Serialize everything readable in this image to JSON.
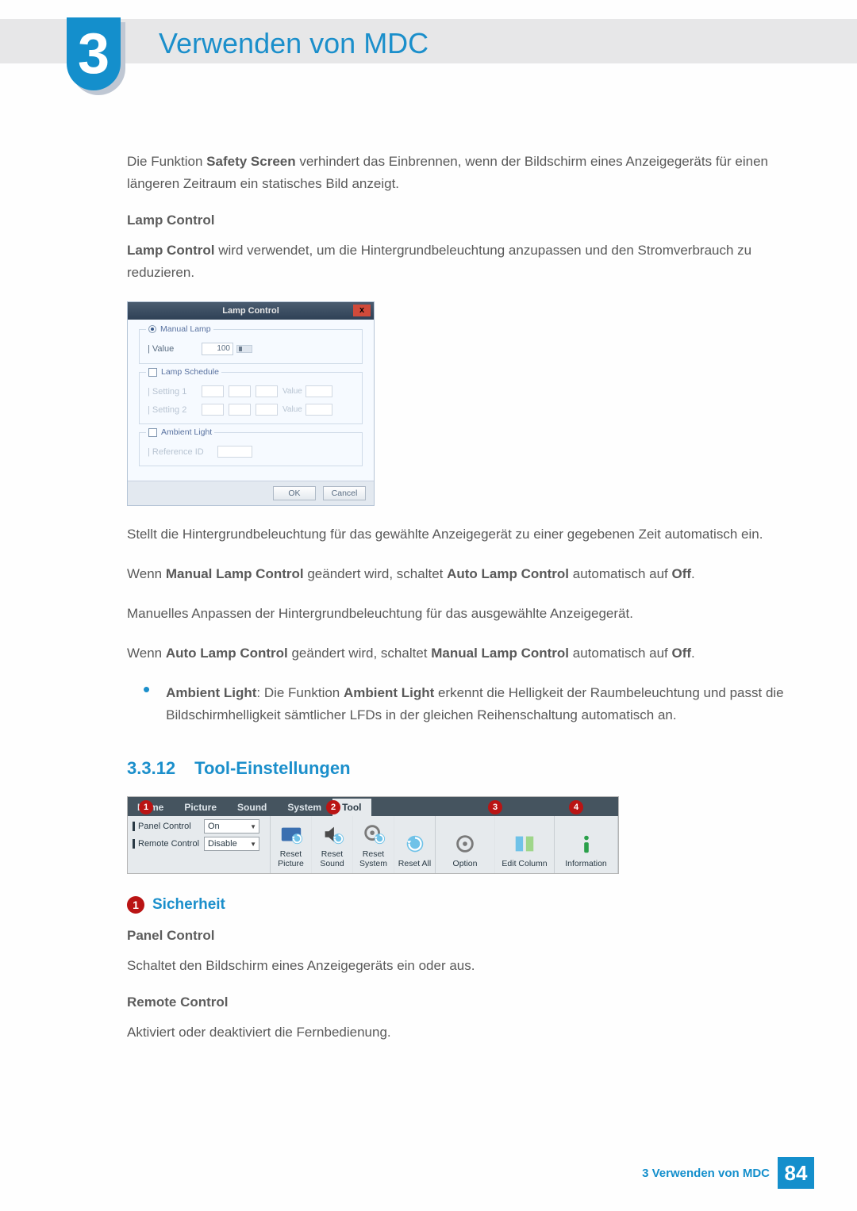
{
  "chapter_badge": "3",
  "chapter_title": "Verwenden von MDC",
  "intro": {
    "p1_pre": "Die Funktion ",
    "p1_b": "Safety Screen",
    "p1_post": " verhindert das Einbrennen, wenn der Bildschirm eines Anzeigegeräts für einen längeren Zeitraum ein statisches Bild anzeigt."
  },
  "lamp": {
    "heading": "Lamp Control",
    "p_pre": "",
    "p_b": "Lamp Control",
    "p_post": " wird verwendet, um die Hintergrundbeleuchtung anzupassen und den Stromverbrauch zu reduzieren.",
    "dialog": {
      "title": "Lamp Control",
      "close": "x",
      "manual_lamp_legend": "Manual Lamp",
      "value_label": "| Value",
      "value_val": "100",
      "schedule_legend": "Lamp Schedule",
      "setting1": "| Setting 1",
      "setting2": "| Setting 2",
      "sched_val_label": "Value",
      "ambient_legend": "Ambient Light",
      "ref_id": "| Reference ID",
      "ok": "OK",
      "cancel": "Cancel"
    },
    "para2": "Stellt die Hintergrundbeleuchtung für das gewählte Anzeigegerät zu einer gegebenen Zeit automatisch ein.",
    "para3_pre": "Wenn ",
    "para3_b1": "Manual Lamp Control",
    "para3_mid": " geändert wird, schaltet ",
    "para3_b2": "Auto Lamp Control",
    "para3_mid2": " automatisch auf ",
    "para3_b3": "Off",
    "para3_end": ".",
    "para4": "Manuelles Anpassen der Hintergrundbeleuchtung für das ausgewählte Anzeigegerät.",
    "para5_pre": "Wenn ",
    "para5_b1": "Auto Lamp Control",
    "para5_mid": " geändert wird, schaltet ",
    "para5_b2": "Manual Lamp Control",
    "para5_mid2": " automatisch auf ",
    "para5_b3": "Off",
    "para5_end": ".",
    "bullet_b1": "Ambient Light",
    "bullet_mid1": ": Die Funktion ",
    "bullet_b2": "Ambient Light",
    "bullet_rest": " erkennt die Helligkeit der Raumbeleuchtung und passt die Bildschirmhelligkeit sämtlicher LFDs in der gleichen Reihenschaltung automatisch an."
  },
  "section": {
    "num": "3.3.12",
    "title": "Tool-Einstellungen"
  },
  "toolbar": {
    "tabs": {
      "home": "Home",
      "picture": "Picture",
      "sound": "Sound",
      "system": "System",
      "tool": "Tool"
    },
    "panel_control_label": "Panel Control",
    "panel_control_value": "On",
    "remote_control_label": "Remote Control",
    "remote_control_value": "Disable",
    "reset_picture": "Reset Picture",
    "reset_sound": "Reset Sound",
    "reset_system": "Reset System",
    "reset_all": "Reset All",
    "option": "Option",
    "edit_column": "Edit Column",
    "information": "Information",
    "badges": {
      "b1": "1",
      "b2": "2",
      "b3": "3",
      "b4": "4"
    }
  },
  "sicherheit": {
    "badge": "1",
    "title": "Sicherheit",
    "panel_h": "Panel Control",
    "panel_p": "Schaltet den Bildschirm eines Anzeigegeräts ein oder aus.",
    "remote_h": "Remote Control",
    "remote_p": "Aktiviert oder deaktiviert die Fernbedienung."
  },
  "footer": {
    "text": "3 Verwenden von MDC",
    "page": "84"
  }
}
